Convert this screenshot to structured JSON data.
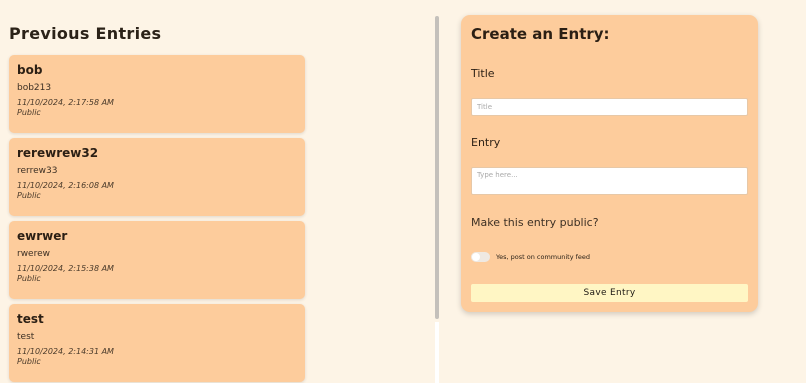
{
  "left": {
    "heading": "Previous Entries",
    "entries": [
      {
        "title": "bob",
        "body": "bob213",
        "date": "11/10/2024, 2:17:58 AM",
        "visibility": "Public"
      },
      {
        "title": "rerewrew32",
        "body": "rerrew33",
        "date": "11/10/2024, 2:16:08 AM",
        "visibility": "Public"
      },
      {
        "title": "ewrwer",
        "body": "rwerew",
        "date": "11/10/2024, 2:15:38 AM",
        "visibility": "Public"
      },
      {
        "title": "test",
        "body": "test",
        "date": "11/10/2024, 2:14:31 AM",
        "visibility": "Public"
      }
    ]
  },
  "form": {
    "heading": "Create an Entry:",
    "title_label": "Title",
    "title_placeholder": "Title",
    "title_value": "",
    "entry_label": "Entry",
    "entry_placeholder": "Type here...",
    "entry_value": "",
    "public_question": "Make this entry public?",
    "toggle_label": "Yes, post on community feed",
    "toggle_on": false,
    "save_label": "Save Entry"
  },
  "colors": {
    "page_background": "#fdf4e6",
    "card_background": "#fdcc9c",
    "save_button": "#fff6c4"
  }
}
